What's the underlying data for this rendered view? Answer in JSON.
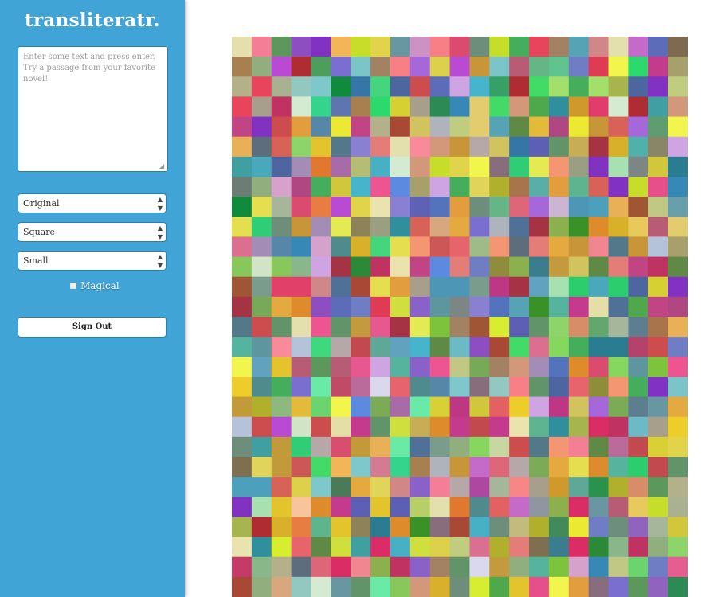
{
  "app": {
    "title": "transliteratr."
  },
  "input": {
    "placeholder": "Enter some text and press enter. Try a passage from your favorite novel!"
  },
  "controls": {
    "color_mode": "Original",
    "shape": "Square",
    "size": "Small",
    "magical_label": "Magical",
    "magical_checked": false
  },
  "account": {
    "signout_label": "Sign Out"
  },
  "mosaic": {
    "icon_name": "mosaic-image",
    "palette": [
      "#62946a",
      "#3f9fa1",
      "#6bbac6",
      "#c39a3a",
      "#eab057",
      "#e2cc6e",
      "#f59673",
      "#67a0ab",
      "#5f9c70",
      "#2b924d",
      "#5c6cb8",
      "#8a80d3",
      "#dc6e8f",
      "#f98a9a",
      "#886e7c",
      "#8e96a1",
      "#c6dd29",
      "#f2f64c",
      "#a53343",
      "#cd4c4e",
      "#da2d65",
      "#e6588f",
      "#4f8b8d",
      "#4fb1a9",
      "#5c975b",
      "#91ae7e",
      "#a94935",
      "#cd5656",
      "#c03262",
      "#3676a6",
      "#60a2c0",
      "#e4c42d",
      "#65b586",
      "#56a3b6",
      "#8bb04d",
      "#5c5fb4",
      "#a667da",
      "#c46ac8",
      "#d8a77e",
      "#2fce76",
      "#4d9d5c",
      "#c2bb7c",
      "#cbb5d1",
      "#d9d8ec",
      "#4b7a58",
      "#2a8a38",
      "#4fa94c",
      "#45d67d",
      "#6aeaa7",
      "#c89638",
      "#e8455d",
      "#c43a8c",
      "#8d4ec1",
      "#de8b2b",
      "#85d75d",
      "#cac931",
      "#c0cd7e",
      "#d4ebd2",
      "#b8ce66",
      "#e47c78",
      "#f97f86",
      "#e63d80",
      "#e65e90",
      "#b6a8a9",
      "#d9d035",
      "#e4ea51",
      "#55b49e",
      "#4ca0bb",
      "#8f8d3b",
      "#43db68",
      "#b75c74",
      "#e14068",
      "#e2772e",
      "#e5aa3f",
      "#df3c54",
      "#6f7dc5",
      "#d39779",
      "#f8c49b",
      "#5d62b4",
      "#3fd97d",
      "#a7e1b1",
      "#d1e4c6",
      "#bd3784",
      "#e5df4f",
      "#2f8f9d",
      "#93c8c1",
      "#d8b02a",
      "#ce91c4",
      "#cfa4e2",
      "#7a6fd1",
      "#6c7d75",
      "#8fb881",
      "#7dc33b",
      "#a3df6b",
      "#8132c3",
      "#b94ad4",
      "#4e66a0",
      "#5686a8",
      "#ee5590",
      "#5373bd",
      "#b4b18a",
      "#c7d7a1",
      "#898567",
      "#3a9127",
      "#e4e0ad",
      "#537889",
      "#44ae5d",
      "#e77d41",
      "#f2b659",
      "#e7c95c",
      "#c0c884",
      "#e4dfa6",
      "#4d96b6",
      "#2a7d91",
      "#5e6d7c",
      "#7c8685",
      "#5aaea8",
      "#7bc4c7",
      "#3688b6",
      "#d18788",
      "#f37e96",
      "#4f7097",
      "#5c7e8e",
      "#9064be",
      "#d37b93",
      "#c14485",
      "#6897a2",
      "#5fa797",
      "#9a9e83",
      "#aab191",
      "#7a9c8d",
      "#5e969f",
      "#c49a3e",
      "#c7ad56",
      "#b4c3d9",
      "#5db48f",
      "#47b0c4",
      "#2c8a55",
      "#36a167",
      "#108a3d",
      "#6c8e7a",
      "#b04682",
      "#7e6f51",
      "#a38163",
      "#dd6679",
      "#46b4ca",
      "#cf9a2b",
      "#e46162",
      "#bb6b99",
      "#e4ba3b",
      "#e0d55a",
      "#5f8a45",
      "#438a5b",
      "#b7bc73",
      "#ebe3ae",
      "#e7646d",
      "#f18590",
      "#e23c6d",
      "#a38cb6",
      "#a79f8b",
      "#a5b69b",
      "#49a8bc",
      "#7ec8cc",
      "#6bd46f",
      "#34d48c",
      "#5fc48d",
      "#bf4b66",
      "#da4b6f",
      "#b0b02c",
      "#d1c35d",
      "#7bab57",
      "#89b78a",
      "#c53a66",
      "#af46a0",
      "#8a61c8",
      "#d08d2f",
      "#e19d3e",
      "#d86258",
      "#f98686",
      "#a7b54e",
      "#8dd56a",
      "#62a76e",
      "#9ebb88",
      "#5e75b0",
      "#d7d032",
      "#edcd29",
      "#ece932",
      "#d7ed30",
      "#e1d44b",
      "#a8a06b",
      "#78a958",
      "#aeb3bc",
      "#d6a2cb",
      "#d0c73b",
      "#8e8258",
      "#a8744b",
      "#3a7d8c",
      "#2ccd6d",
      "#2cd96d",
      "#a86ba8",
      "#7e6b4f",
      "#b4436c",
      "#88c85b",
      "#c2494e",
      "#af2d32",
      "#a05535",
      "#5c8ae1",
      "#a87f4e",
      "#e64f8a",
      "#cfdf3d",
      "#ddd04a",
      "#e39d3c",
      "#d78d67",
      "#d94e6f"
    ],
    "cols": 23,
    "rows": 28
  }
}
